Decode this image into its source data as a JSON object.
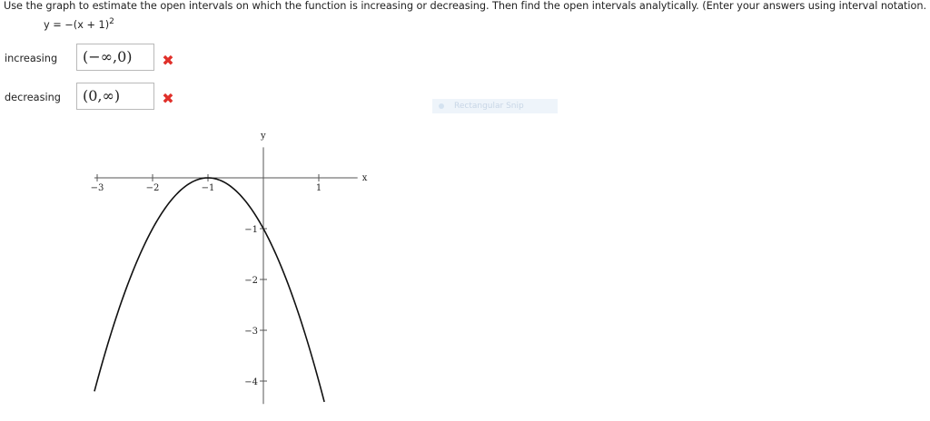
{
  "question": {
    "instructions": "Use the graph to estimate the open intervals on which the function is increasing or decreasing. Then find the open intervals analytically. (Enter your answers using interval notation.",
    "equation_lhs": "y = −(x + 1)",
    "equation_exp": "2"
  },
  "answers": [
    {
      "label": "increasing",
      "value": "(−∞,0)",
      "status": "incorrect"
    },
    {
      "label": "decreasing",
      "value": "(0,∞)",
      "status": "incorrect"
    }
  ],
  "status_mark": "✖",
  "snip_tool": {
    "label": "Rectangular Snip"
  },
  "colors": {
    "incorrect": "#e0302a",
    "curve": "#111111"
  },
  "chart_data": {
    "type": "line",
    "title": "",
    "xlabel": "x",
    "ylabel": "y",
    "xlim": [
      -3.05,
      1.7
    ],
    "ylim": [
      -4.45,
      0.6
    ],
    "x_ticks": [
      -3,
      -2,
      -1,
      1
    ],
    "x_tick_labels": [
      "−3",
      "−2",
      "−1",
      "1"
    ],
    "y_ticks": [
      -1,
      -2,
      -3,
      -4
    ],
    "y_tick_labels": [
      "−1",
      "−2",
      "−3",
      "−4"
    ],
    "series": [
      {
        "x": [
          -3.05,
          -2.75,
          -2.5,
          -2.25,
          -2.0,
          -1.75,
          -1.5,
          -1.25,
          -1.0,
          -0.75,
          -0.5,
          -0.25,
          0.0,
          0.25,
          0.5,
          0.75,
          1.1
        ],
        "y": [
          -4.2,
          -3.06,
          -2.25,
          -1.56,
          -1.0,
          -0.56,
          -0.25,
          -0.06,
          0.0,
          -0.06,
          -0.25,
          -0.56,
          -1.0,
          -1.56,
          -2.25,
          -3.06,
          -4.41
        ]
      }
    ],
    "grid": false,
    "legend": "none"
  }
}
